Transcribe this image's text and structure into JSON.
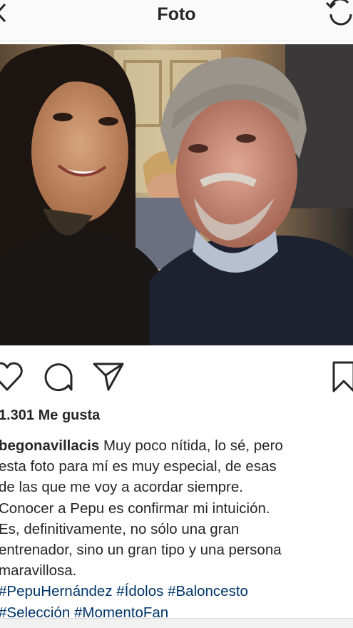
{
  "header": {
    "title": "Foto",
    "back_icon": "chevron-left-icon",
    "refresh_icon": "refresh-icon"
  },
  "post": {
    "photo_alt": "Selfie de dos personas",
    "actions": {
      "like_icon": "heart-outline-icon",
      "comment_icon": "comment-bubble-icon",
      "share_icon": "paper-plane-icon",
      "save_icon": "bookmark-icon"
    },
    "likes_text": "1.301 Me gusta",
    "caption": {
      "username": "begonavillacis",
      "lines": [
        " Muy poco nítida, lo sé, pero",
        "esta foto para mí es muy especial, de esas",
        "de las que me voy a acordar siempre.",
        "Conocer a Pepu es confirmar mi intuición.",
        "Es, definitivamente, no sólo una gran",
        "entrenador, sino un gran tipo y una persona",
        "maravillosa."
      ],
      "hashtag_lines": [
        [
          "#PepuHernández",
          "#Ídolos",
          "#Baloncesto"
        ],
        [
          "#Selección",
          "#MomentoFan"
        ]
      ]
    }
  },
  "colors": {
    "text": "#262626",
    "hashtag": "#003569",
    "header_bg": "#fafafa"
  }
}
